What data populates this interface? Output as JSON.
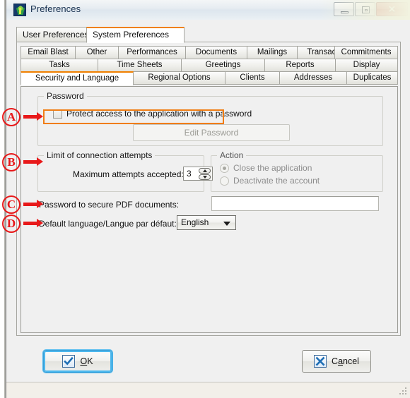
{
  "window": {
    "title": "Preferences",
    "app_icon": "app-logo-icon",
    "controls": {
      "minimize": "–",
      "restore": "□",
      "close": "✕"
    }
  },
  "top_tabs": [
    {
      "label": "User Preferences",
      "active": false
    },
    {
      "label": "System Preferences",
      "active": true
    }
  ],
  "inner_tabs": {
    "row1": [
      {
        "label": "Email Blast"
      },
      {
        "label": "Other"
      },
      {
        "label": "Performances"
      },
      {
        "label": "Documents"
      },
      {
        "label": "Mailings"
      },
      {
        "label": "Transactions"
      },
      {
        "label": "Commitments"
      }
    ],
    "row2": [
      {
        "label": "Tasks"
      },
      {
        "label": "Time Sheets"
      },
      {
        "label": "Greetings"
      },
      {
        "label": "Reports"
      },
      {
        "label": "Display"
      }
    ],
    "row3": [
      {
        "label": "Security and Language",
        "active": true
      },
      {
        "label": "Regional Options"
      },
      {
        "label": "Clients"
      },
      {
        "label": "Addresses"
      },
      {
        "label": "Duplicates"
      }
    ]
  },
  "password_group": {
    "legend": "Password",
    "checkbox_label": "Protect access to the application with a password",
    "checkbox_checked": false,
    "edit_password_button": "Edit Password",
    "edit_password_enabled": false
  },
  "limit_group": {
    "legend": "Limit of connection attempts",
    "max_attempts_label": "Maximum attempts accepted:",
    "max_attempts_value": "3"
  },
  "action_group": {
    "legend": "Action",
    "options": [
      {
        "label": "Close the application",
        "selected": true
      },
      {
        "label": "Deactivate the account",
        "selected": false
      }
    ],
    "enabled": false
  },
  "pdf_password": {
    "label": "Password to secure PDF documents:",
    "value": "",
    "placeholder": ""
  },
  "default_language": {
    "label": "Default language/Langue par défaut:",
    "value": "English"
  },
  "buttons": {
    "ok": {
      "label": "OK",
      "mnemonic": "O",
      "icon": "check-icon",
      "focused": true
    },
    "cancel": {
      "label": "Cancel",
      "mnemonic": "a",
      "icon": "x-icon",
      "focused": false
    }
  },
  "annotations": {
    "markers": [
      {
        "letter": "A",
        "target": "protect-access-checkbox"
      },
      {
        "letter": "B",
        "target": "limit-of-connection-attempts-group"
      },
      {
        "letter": "C",
        "target": "pdf-password-field"
      },
      {
        "letter": "D",
        "target": "default-language-select"
      }
    ],
    "highlight_color": "#f07d14",
    "marker_color": "#e8191a"
  }
}
